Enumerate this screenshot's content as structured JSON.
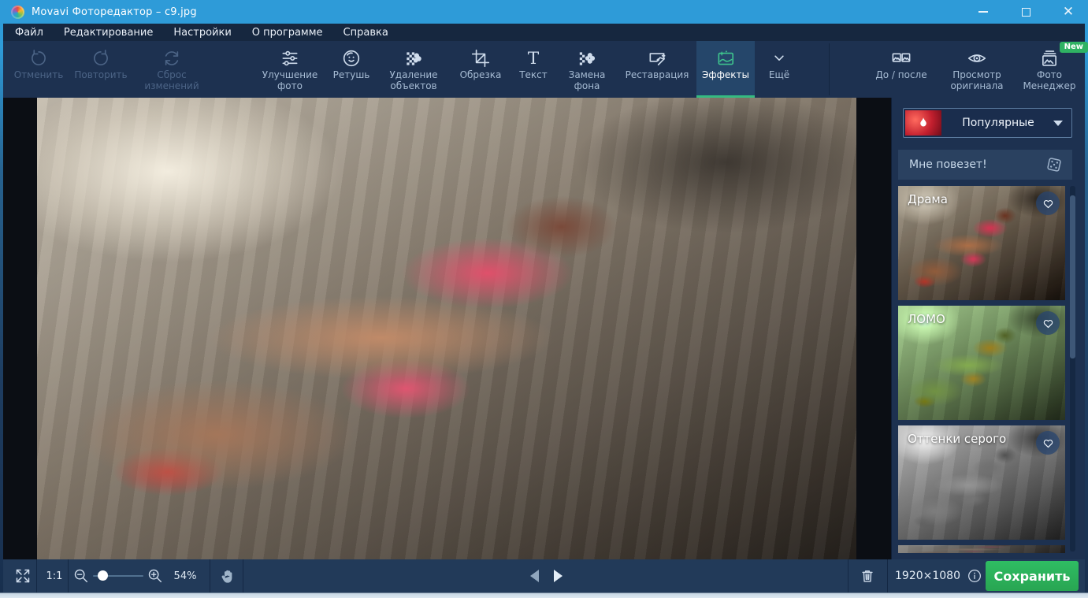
{
  "titlebar": {
    "app_icon": "movavi-logo-icon",
    "title": "Movavi Фоторедактор – c9.jpg",
    "controls": [
      "minimize-icon",
      "maximize-icon",
      "close-icon"
    ]
  },
  "menubar": {
    "items": [
      "Файл",
      "Редактирование",
      "Настройки",
      "О программе",
      "Справка"
    ]
  },
  "toolbar": {
    "history": [
      {
        "label": "Отменить",
        "icon": "undo-icon",
        "disabled": true
      },
      {
        "label": "Повторить",
        "icon": "redo-icon",
        "disabled": true
      },
      {
        "label": "Сброс изменений",
        "icon": "reset-icon",
        "disabled": true
      }
    ],
    "tools": [
      {
        "label": "Улучшение фото",
        "icon": "adjust-sliders-icon"
      },
      {
        "label": "Ретушь",
        "icon": "retouch-face-icon"
      },
      {
        "label": "Удаление объектов",
        "icon": "object-removal-icon"
      },
      {
        "label": "Обрезка",
        "icon": "crop-icon"
      },
      {
        "label": "Текст",
        "icon": "text-icon"
      },
      {
        "label": "Замена фона",
        "icon": "background-replace-icon"
      },
      {
        "label": "Реставрация",
        "icon": "restoration-icon"
      },
      {
        "label": "Эффекты",
        "icon": "effects-icon",
        "active": true
      },
      {
        "label": "Ещё",
        "icon": "chevron-down-icon"
      }
    ],
    "view": [
      {
        "label": "До / после",
        "icon": "before-after-icon"
      },
      {
        "label": "Просмотр оригинала",
        "icon": "eye-icon"
      },
      {
        "label": "Фото Менеджер",
        "icon": "photo-manager-icon",
        "badge": "New"
      }
    ]
  },
  "effects_panel": {
    "category": {
      "label": "Популярные",
      "icon": "flame-icon"
    },
    "lucky": {
      "label": "Мне повезет!",
      "icon": "dice-icon"
    },
    "effects": [
      {
        "name": "Драма"
      },
      {
        "name": "ЛОМО"
      },
      {
        "name": "Оттенки серого"
      }
    ]
  },
  "statusbar": {
    "actual_size": "1:1",
    "zoom_percent": "54%",
    "dimensions": "1920×1080",
    "save_label": "Сохранить"
  },
  "colors": {
    "titlebar_blue": "#2e9bd8",
    "toolbar_navy": "#1d3150",
    "effects_green": "#3ec28d",
    "save_green": "#2bb15a",
    "badge_green": "#2fb263"
  }
}
